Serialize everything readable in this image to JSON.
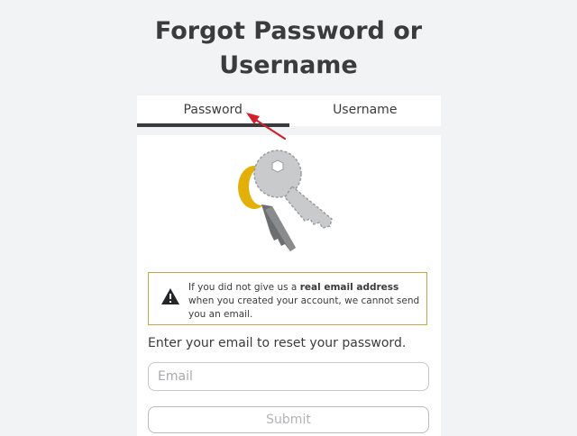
{
  "page": {
    "title": "Forgot Password or\nUsername"
  },
  "tabs": [
    {
      "label": "Password",
      "active": true
    },
    {
      "label": "Username",
      "active": false
    }
  ],
  "notice": {
    "prefix": "If you did not give us a ",
    "emphasis": "real email address",
    "suffix": " when you created your account, we cannot send you an email.",
    "icon": "warning-icon"
  },
  "form": {
    "instruction": "Enter your email to reset your password.",
    "email_placeholder": "Email",
    "email_value": "",
    "submit_label": "Submit"
  },
  "colors": {
    "background": "#f2f3f5",
    "text": "#393b3d",
    "notice_border": "#c9a449",
    "annotation_arrow": "#d0202b",
    "key_gold": "#e2b007",
    "key_gray": "#c9cacb"
  }
}
